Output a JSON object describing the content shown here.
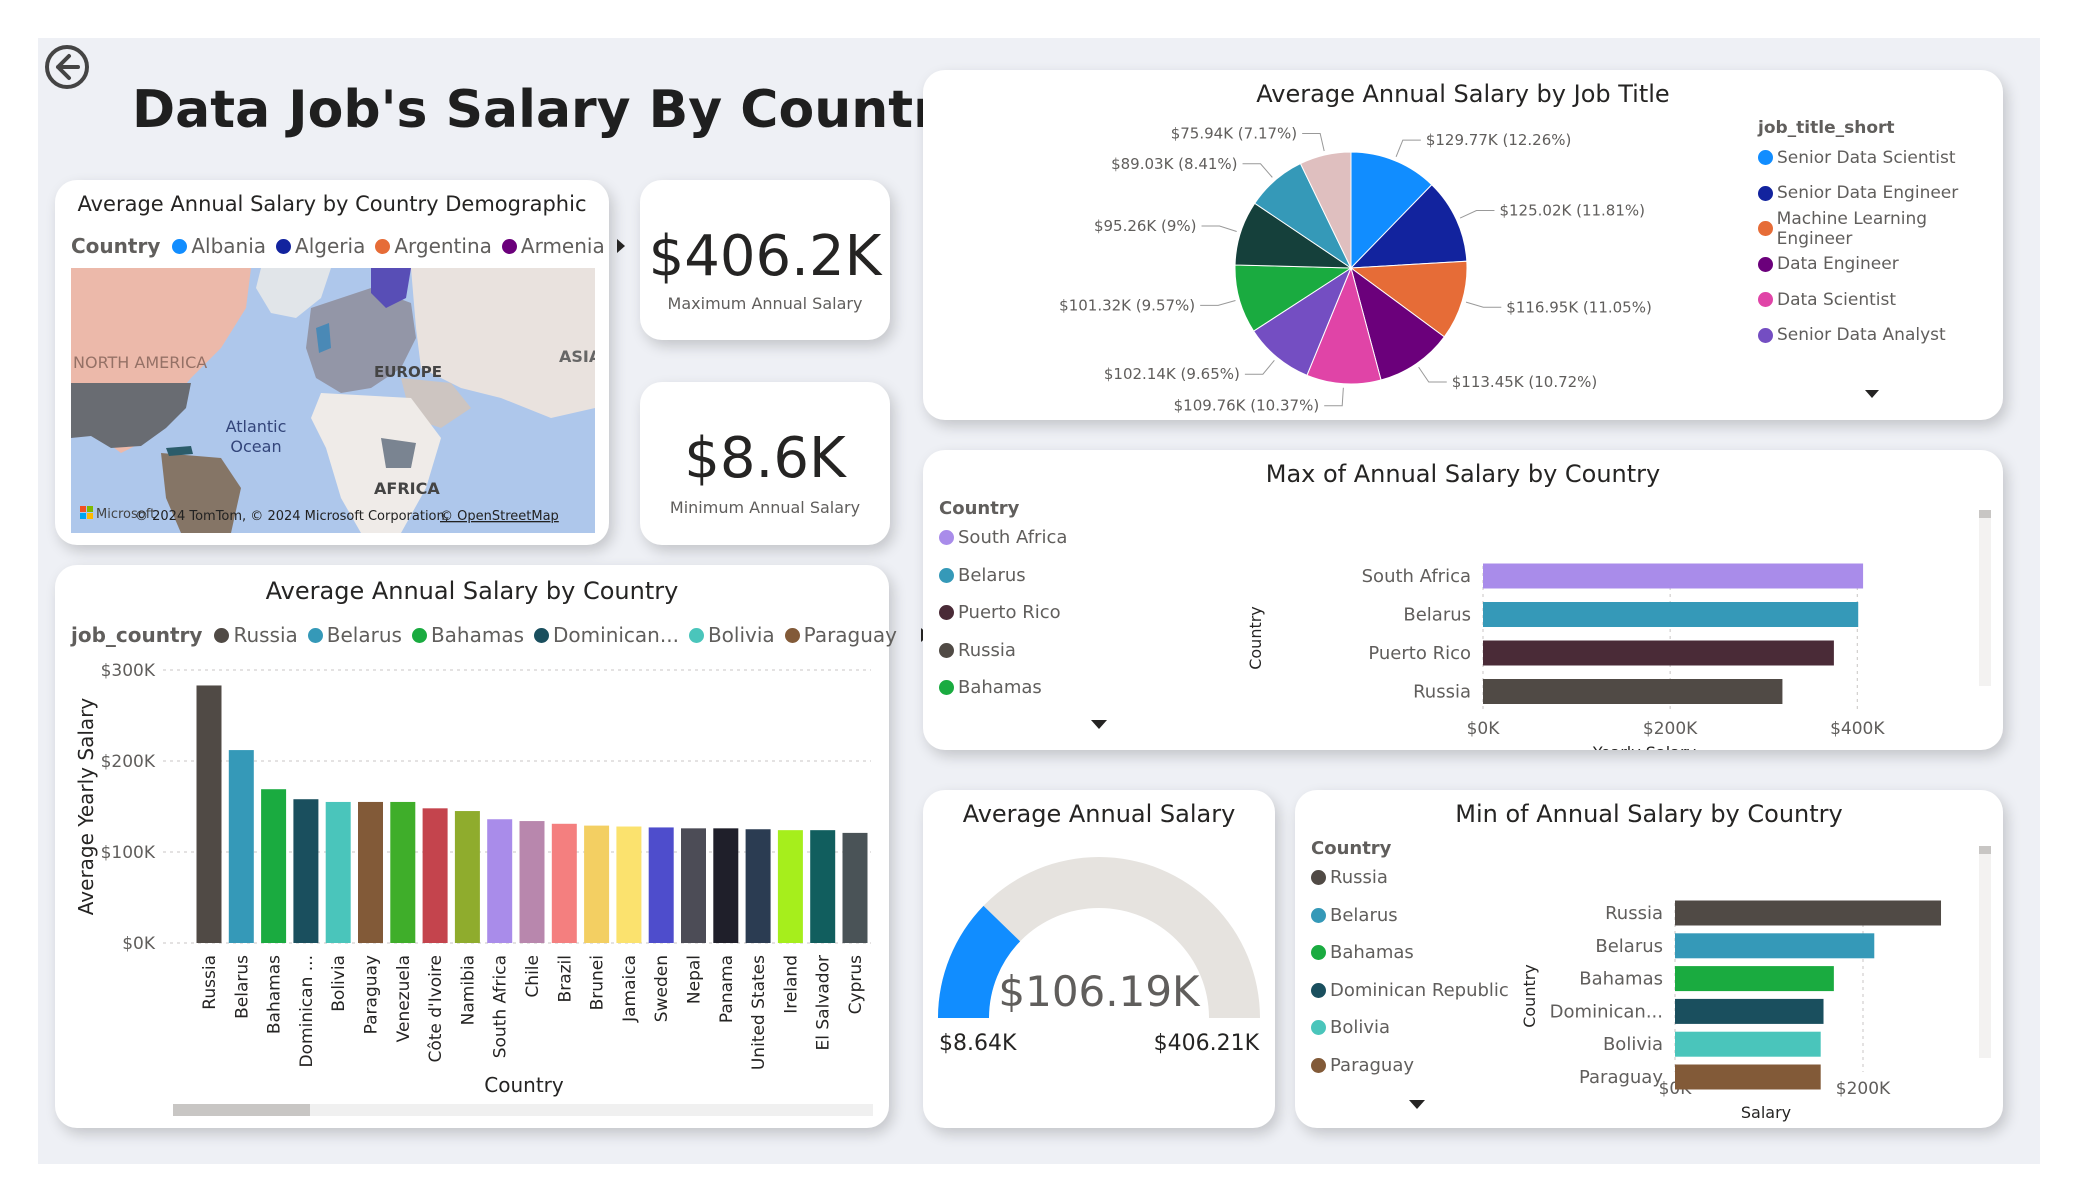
{
  "page": {
    "title": "Data Job's Salary By Country"
  },
  "map": {
    "title": "Average Annual Salary by Country Demographic",
    "legend_title": "Country",
    "legend": [
      {
        "label": "Albania",
        "color": "#118dff"
      },
      {
        "label": "Algeria",
        "color": "#12239e"
      },
      {
        "label": "Argentina",
        "color": "#e66c37"
      },
      {
        "label": "Armenia",
        "color": "#6b007b"
      }
    ],
    "labels": {
      "north_america": "NORTH AMERICA",
      "europe": "EUROPE",
      "asia": "ASIA",
      "atlantic": "Atlantic\nOcean",
      "africa": "AFRICA"
    },
    "attribution": "© 2024 TomTom, © 2024 Microsoft Corporation,",
    "osm_link": "© OpenStreetMap",
    "ms_logo": "Microsoft"
  },
  "kpi_max": {
    "value": "$406.2K",
    "label": "Maximum Annual Salary"
  },
  "kpi_min": {
    "value": "$8.6K",
    "label": "Minimum Annual Salary"
  },
  "pie": {
    "title": "Average Annual Salary by Job Title",
    "legend_title": "job_title_short",
    "chart_data": {
      "type": "pie",
      "title": "Average Annual Salary by Job Title",
      "legend_title": "job_title_short",
      "slices": [
        {
          "label": "Senior Data Scientist",
          "value": 129.77,
          "pct": 12.26,
          "text": "$129.77K (12.26%)",
          "color": "#118dff",
          "in_legend": true
        },
        {
          "label": "Senior Data Engineer",
          "value": 125.02,
          "pct": 11.81,
          "text": "$125.02K (11.81%)",
          "color": "#12239e",
          "in_legend": true
        },
        {
          "label": "Machine Learning Engineer",
          "value": 116.95,
          "pct": 11.05,
          "text": "$116.95K (11.05%)",
          "color": "#e66c37",
          "in_legend": true
        },
        {
          "label": "Data Engineer",
          "value": 113.45,
          "pct": 10.72,
          "text": "$113.45K (10.72%)",
          "color": "#6b007b",
          "in_legend": true
        },
        {
          "label": "Data Scientist",
          "value": 109.76,
          "pct": 10.37,
          "text": "$109.76K (10.37%)",
          "color": "#e044a7",
          "in_legend": true
        },
        {
          "label": "Senior Data Analyst",
          "value": 102.14,
          "pct": 9.65,
          "text": "$102.14K (9.65%)",
          "color": "#744ec2",
          "in_legend": true
        },
        {
          "label": "",
          "value": 101.32,
          "pct": 9.57,
          "text": "$101.32K (9.57%)",
          "color": "#1aab40",
          "in_legend": false
        },
        {
          "label": "",
          "value": 95.26,
          "pct": 9.0,
          "text": "$95.26K (9%)",
          "color": "#15403b",
          "in_legend": false
        },
        {
          "label": "",
          "value": 89.03,
          "pct": 8.41,
          "text": "$89.03K (8.41%)",
          "color": "#3599b8",
          "in_legend": false
        },
        {
          "label": "",
          "value": 75.94,
          "pct": 7.17,
          "text": "$75.94K (7.17%)",
          "color": "#dfbfbf",
          "in_legend": false
        }
      ]
    }
  },
  "bar_country": {
    "title": "Average Annual Salary by Country",
    "legend_title": "job_country",
    "legend": [
      {
        "label": "Russia",
        "color": "#504a45"
      },
      {
        "label": "Belarus",
        "color": "#3599b8"
      },
      {
        "label": "Bahamas",
        "color": "#1aab40"
      },
      {
        "label": "Dominican...",
        "color": "#1a4f5e"
      },
      {
        "label": "Bolivia",
        "color": "#4ac5bb"
      },
      {
        "label": "Paraguay",
        "color": "#825a38"
      }
    ],
    "chart_data": {
      "type": "bar",
      "title": "Average Annual Salary by Country",
      "xlabel": "Country",
      "ylabel": "Average Yearly Salary",
      "ylim": [
        0,
        300000
      ],
      "yticks": [
        "$0K",
        "$100K",
        "$200K",
        "$300K"
      ],
      "ytick_values": [
        0,
        100000,
        200000,
        300000
      ],
      "categories": [
        "Russia",
        "Belarus",
        "Bahamas",
        "Dominican ...",
        "Bolivia",
        "Paraguay",
        "Venezuela",
        "Côte d'Ivoire",
        "Namibia",
        "South Africa",
        "Chile",
        "Brazil",
        "Brunei",
        "Jamaica",
        "Sweden",
        "Nepal",
        "Panama",
        "United States",
        "Ireland",
        "El Salvador",
        "Cyprus"
      ],
      "values": [
        283000,
        212000,
        169000,
        158000,
        155000,
        155000,
        155000,
        148000,
        145000,
        136000,
        134000,
        131000,
        129000,
        128000,
        127000,
        126000,
        126000,
        125000,
        124000,
        124000,
        121000
      ],
      "colors": [
        "#504a45",
        "#3599b8",
        "#1aab40",
        "#1a4f5e",
        "#4ac5bb",
        "#825a38",
        "#3fae2a",
        "#c4444d",
        "#8fac2d",
        "#a98cea",
        "#b887ad",
        "#f47f7f",
        "#f3cf62",
        "#fbe26e",
        "#4e4dcc",
        "#4c4c56",
        "#1f1f2a",
        "#2b3c52",
        "#a6ee1c",
        "#115e5e",
        "#4a5357"
      ]
    }
  },
  "bar_max": {
    "title": "Max of Annual Salary by Country",
    "legend_title": "Country",
    "legend": [
      {
        "label": "South Africa",
        "color": "#a98cea"
      },
      {
        "label": "Belarus",
        "color": "#3599b8"
      },
      {
        "label": "Puerto Rico",
        "color": "#4a2b37"
      },
      {
        "label": "Russia",
        "color": "#504a45"
      },
      {
        "label": "Bahamas",
        "color": "#1aab40"
      }
    ],
    "chart_data": {
      "type": "bar",
      "title": "Max of Annual Salary by Country",
      "xlabel": "Yearly Salary",
      "ylabel": "Country",
      "xlim": [
        0,
        420000
      ],
      "xticks": [
        "$0K",
        "$200K",
        "$400K"
      ],
      "xtick_values": [
        0,
        200000,
        400000
      ],
      "categories": [
        "South Africa",
        "Belarus",
        "Puerto Rico",
        "Russia"
      ],
      "values": [
        406200,
        401000,
        375000,
        320000
      ],
      "colors": [
        "#a98cea",
        "#3599b8",
        "#4a2b37",
        "#504a45"
      ]
    }
  },
  "gauge": {
    "title": "Average Annual Salary",
    "value_text": "$106.19K",
    "min_text": "$8.64K",
    "max_text": "$406.21K",
    "chart_data": {
      "type": "gauge",
      "min": 8.64,
      "max": 406.21,
      "value": 106.19
    }
  },
  "bar_min": {
    "title": "Min of Annual Salary by Country",
    "legend_title": "Country",
    "legend": [
      {
        "label": "Russia",
        "color": "#504a45"
      },
      {
        "label": "Belarus",
        "color": "#3599b8"
      },
      {
        "label": "Bahamas",
        "color": "#1aab40"
      },
      {
        "label": "Dominican Republic",
        "color": "#1a4f5e"
      },
      {
        "label": "Bolivia",
        "color": "#4ac5bb"
      },
      {
        "label": "Paraguay",
        "color": "#825a38"
      }
    ],
    "chart_data": {
      "type": "bar",
      "title": "Min of Annual Salary by Country",
      "xlabel": "Salary",
      "ylabel": "Country",
      "xlim": [
        0,
        300000
      ],
      "xticks": [
        "$0K",
        "$200K"
      ],
      "xtick_values": [
        0,
        200000
      ],
      "categories": [
        "Russia",
        "Belarus",
        "Bahamas",
        "Dominican...",
        "Bolivia",
        "Paraguay"
      ],
      "values": [
        283000,
        212000,
        169000,
        158000,
        155000,
        155000
      ],
      "colors": [
        "#504a45",
        "#3599b8",
        "#1aab40",
        "#1a4f5e",
        "#4ac5bb",
        "#825a38"
      ]
    }
  }
}
